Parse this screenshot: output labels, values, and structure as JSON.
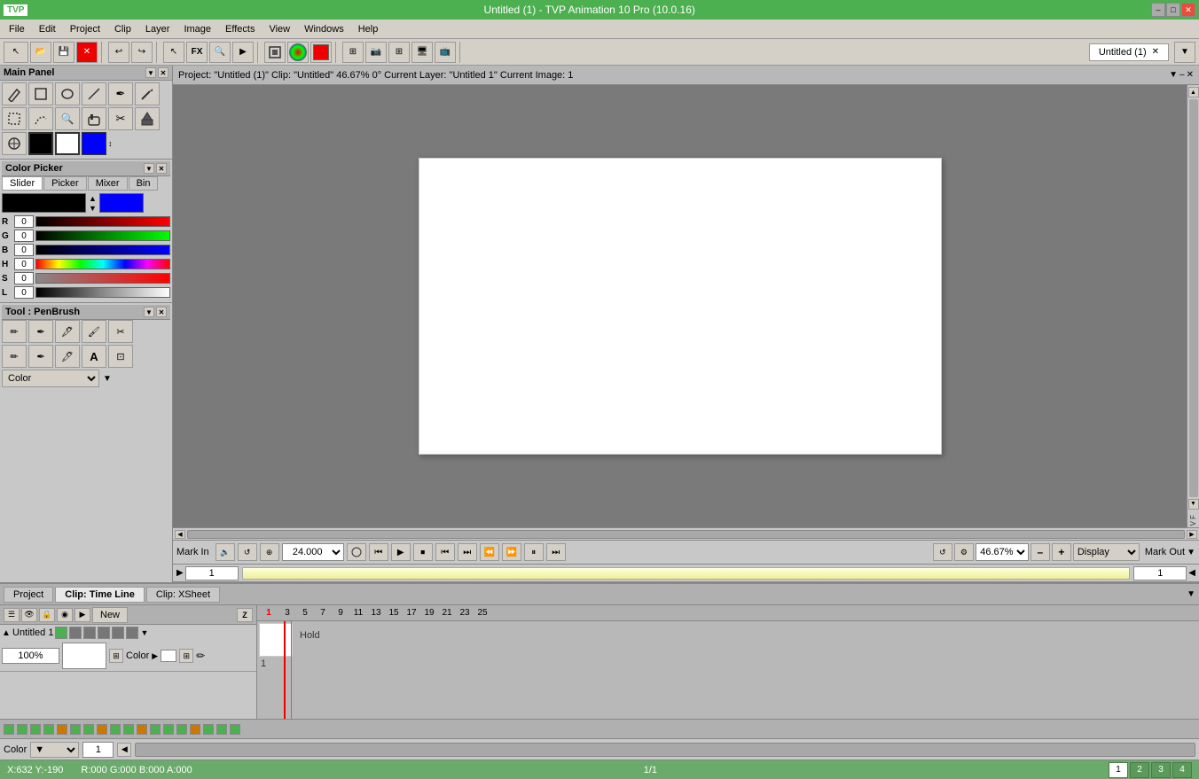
{
  "app": {
    "title": "Untitled (1) - TVP Animation 10 Pro (10.0.16)",
    "tvp_logo": "TVP"
  },
  "window_controls": {
    "minimize": "–",
    "maximize": "□",
    "close": "✕"
  },
  "menu": {
    "items": [
      "File",
      "Edit",
      "Project",
      "Clip",
      "Layer",
      "Image",
      "Effects",
      "View",
      "Windows",
      "Help"
    ]
  },
  "toolbar": {
    "buttons": [
      "↩",
      "↪",
      "FX",
      "🔍",
      "▶",
      "⚙",
      "●",
      "■",
      "⊞",
      "✂",
      "⊟",
      "⊕",
      "≡",
      "↕",
      "⊞"
    ]
  },
  "tabs": {
    "items": [
      {
        "label": "Untitled (1)",
        "active": true
      }
    ]
  },
  "project_bar": {
    "text": "Project: \"Untitled (1)\"  Clip: \"Untitled\"  46.67%  0°  Current Layer: \"Untitled 1\"  Current Image: 1"
  },
  "main_panel": {
    "title": "Main Panel"
  },
  "color_picker": {
    "title": "Color Picker",
    "tabs": [
      "Slider",
      "Picker",
      "Mixer",
      "Bin"
    ],
    "active_tab": "Slider",
    "main_color": "#000000",
    "secondary_color": "#0000ff",
    "sliders": [
      {
        "label": "R",
        "value": "0",
        "type": "r"
      },
      {
        "label": "G",
        "value": "0",
        "type": "g"
      },
      {
        "label": "B",
        "value": "0",
        "type": "b"
      },
      {
        "label": "H",
        "value": "0",
        "type": "h"
      },
      {
        "label": "S",
        "value": "0",
        "type": "s"
      },
      {
        "label": "L",
        "value": "0",
        "type": "l"
      }
    ]
  },
  "pen_brush": {
    "title": "Tool : PenBrush",
    "color_label": "Color",
    "tools": [
      "✏",
      "✒",
      "🖋",
      "🖌",
      "✂",
      "🖊",
      "✏",
      "A",
      "⊡"
    ]
  },
  "transport": {
    "fps": "24.000",
    "zoom": "46.67%",
    "mark_in": "Mark In",
    "mark_out": "Mark Out",
    "display": "Display",
    "frame_value": "1",
    "frame_value2": "1"
  },
  "timeline_tabs": {
    "items": [
      {
        "label": "Project",
        "active": false
      },
      {
        "label": "Clip: Time Line",
        "active": true
      },
      {
        "label": "Clip: XSheet",
        "active": false
      }
    ]
  },
  "layer": {
    "name": "Untitled 1",
    "new_label": "New",
    "opacity": "100%",
    "color_label": "Color",
    "frame_markers": [
      "1",
      "3",
      "5",
      "7",
      "9",
      "11",
      "13",
      "15",
      "17",
      "19",
      "21",
      "23",
      "25"
    ],
    "hold_label": "Hold"
  },
  "checks": {
    "items": [
      "",
      "",
      "",
      "",
      "",
      "",
      "",
      "",
      "",
      "",
      "",
      "",
      "",
      "",
      "",
      "",
      "",
      ""
    ]
  },
  "bottom_color": {
    "label": "Color",
    "dropdown": "▼",
    "frame": "1",
    "frame_total": "1/1"
  },
  "status": {
    "coords": "X:632 Y:-190",
    "color_info": "R:000 G:000 B:000 A:000",
    "page": "1/1",
    "tabs": [
      "1",
      "2",
      "3",
      "4"
    ]
  }
}
